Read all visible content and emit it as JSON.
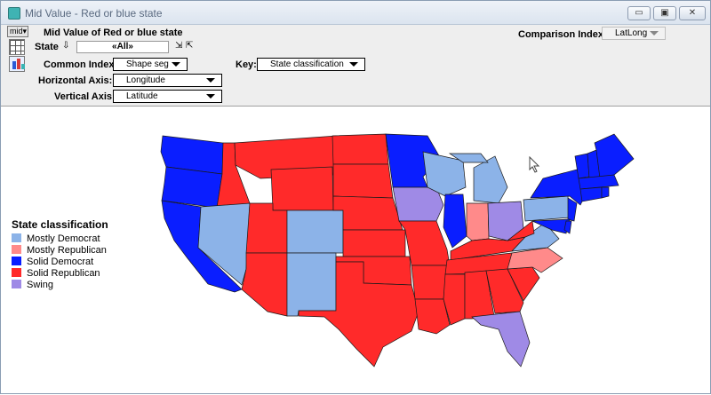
{
  "window": {
    "title": "Mid Value - Red or blue state",
    "controls": {
      "minimize": "▭",
      "maximize": "▣",
      "close": "✕"
    }
  },
  "toolbar": {
    "mid_button": "mid▾",
    "heading": "Mid Value of Red or blue state",
    "state_label": "State",
    "state_value": "«All»",
    "comparison_label": "Comparison Index:",
    "comparison_value": "LatLong",
    "common_index_label": "Common Index:",
    "common_index_value": "Shape seg",
    "key_label": "Key:",
    "key_value": "State classification",
    "horizontal_label": "Horizontal Axis:",
    "horizontal_value": "Longitude",
    "vertical_label": "Vertical Axis:",
    "vertical_value": "Latitude"
  },
  "legend": {
    "title": "State classification",
    "items": [
      {
        "label": "Mostly Democrat",
        "color": "#8cb3e8"
      },
      {
        "label": "Mostly Republican",
        "color": "#ff8a8a"
      },
      {
        "label": "Solid Democrat",
        "color": "#0a1eff"
      },
      {
        "label": "Solid Republican",
        "color": "#ff2a2a"
      },
      {
        "label": "Swing",
        "color": "#9f8ae6"
      }
    ]
  },
  "colors": {
    "mostly_democrat": "#8cb3e8",
    "mostly_republican": "#ff8a8a",
    "solid_democrat": "#0a1eff",
    "solid_republican": "#ff2a2a",
    "swing": "#9f8ae6"
  },
  "icons": [
    "app-icon",
    "grid-icon",
    "chart-icon",
    "down-arrow-icon",
    "pin-icon",
    "mouse-cursor-icon"
  ]
}
